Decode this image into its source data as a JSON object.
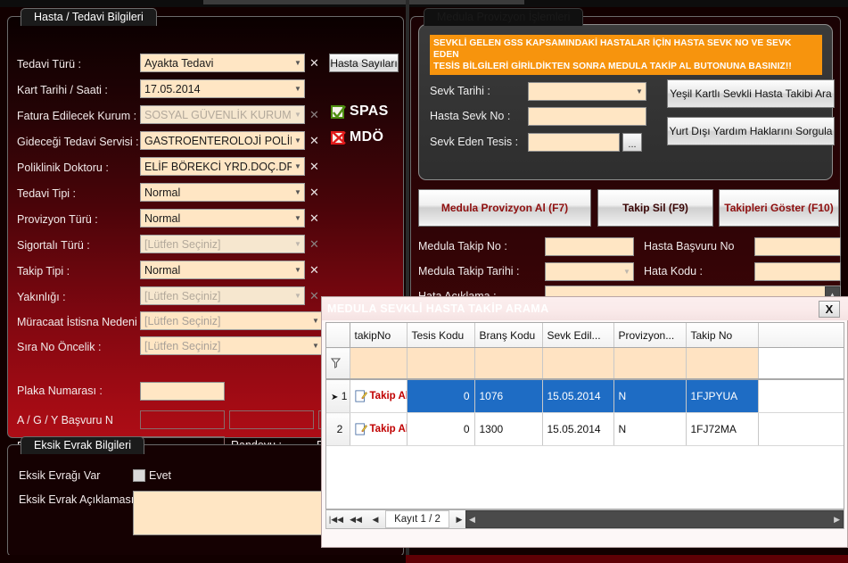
{
  "left_panel": {
    "title": "Hasta / Tedavi Bilgileri",
    "fields": [
      {
        "label": "Tedavi Türü :",
        "value": "Ayakta Tedavi",
        "disabled": false,
        "dropdown": true,
        "clear": true
      },
      {
        "label": "Kart Tarihi / Saati :",
        "value": "17.05.2014",
        "disabled": false,
        "dropdown": true,
        "clear": false
      },
      {
        "label": "Fatura Edilecek Kurum :",
        "value": "SOSYAL GÜVENLİK KURUMU (SGK)",
        "disabled": true,
        "dropdown": true,
        "clear": true
      },
      {
        "label": "Gideceği Tedavi Servisi :",
        "value": "GASTROENTEROLOJİ POLİK...",
        "disabled": false,
        "dropdown": true,
        "clear": true
      },
      {
        "label": "Poliklinik Doktoru :",
        "value": "ELİF BÖREKCİ YRD.DOÇ.DR.",
        "disabled": false,
        "dropdown": true,
        "clear": true
      },
      {
        "label": "Tedavi Tipi  :",
        "value": "Normal",
        "disabled": false,
        "dropdown": true,
        "clear": true
      },
      {
        "label": "Provizyon Türü :",
        "value": "Normal",
        "disabled": false,
        "dropdown": true,
        "clear": true
      },
      {
        "label": "Sigortalı Türü :",
        "value": "[Lütfen Seçiniz]",
        "disabled": true,
        "dropdown": true,
        "clear": true
      },
      {
        "label": "Takip Tipi :",
        "value": "Normal",
        "disabled": false,
        "dropdown": true,
        "clear": true
      },
      {
        "label": "Yakınlığı :",
        "value": "[Lütfen Seçiniz]",
        "disabled": true,
        "dropdown": true,
        "clear": true
      },
      {
        "label": "Müracaat İstisna Nedeni",
        "value": "[Lütfen Seçiniz]",
        "disabled": false,
        "dropdown": true,
        "clear": false
      },
      {
        "label": "Sıra No Öncelik   :",
        "value": "[Lütfen Seçiniz]",
        "disabled": false,
        "dropdown": true,
        "clear": false
      }
    ],
    "plaka_label": "Plaka Numarası :",
    "plaka_value": "",
    "agy_label": "A / G / Y Başvuru N",
    "fatura_no_label": "Fatura No :",
    "fatura_no_value": "",
    "randevu_label": "Randevu :",
    "randevu_value": "Ra",
    "hasta_sayilari_button": "Hasta Sayıları",
    "flags": [
      {
        "name": "SPAS",
        "state": "check",
        "color": "#4f8f12"
      },
      {
        "name": "MDÖ",
        "state": "cross",
        "color": "#e01b1b"
      }
    ]
  },
  "eksik_panel": {
    "title": "Eksik Evrak Bilgileri",
    "has_missing_label": "Eksik Evrağı Var",
    "checkbox_label": "Evet",
    "checkbox_checked": false,
    "description_label": "Eksik Evrak Açıklaması",
    "description_value": ""
  },
  "right_panel": {
    "title": "Medula Provizyon İşlemleri",
    "warning_line1": "SEVKLİ GELEN GSS KAPSAMINDAKİ HASTALAR İÇİN  HASTA SEVK NO VE SEVK EDEN",
    "warning_line2": "TESİS BİLGİLERİ GİRİLDİKTEN SONRA MEDULA TAKİP AL BUTONUNA BASINIZ!!",
    "warning_color": "#f7940d",
    "sevk_fields": [
      {
        "label": "Sevk Tarihi :",
        "value": "",
        "dropdown": true
      },
      {
        "label": "Hasta Sevk No :",
        "value": "",
        "dropdown": false
      },
      {
        "label": "Sevk Eden Tesis :",
        "value": "",
        "dropdown": false
      }
    ],
    "dots_button": "...",
    "side_buttons": [
      "Yeşil Kartlı Sevkli Hasta Takibi Ara",
      "Yurt Dışı Yardım Haklarını Sorgula"
    ],
    "action_buttons": [
      {
        "label": "Medula Provizyon Al (F7)",
        "color": "#8f0f0f"
      },
      {
        "label": "Takip Sil (F9)",
        "color": "#3a0606"
      },
      {
        "label": "Takipleri Göster (F10)",
        "color": "#8f0f0f"
      }
    ],
    "medula_fields": [
      {
        "label": "Medula Takip No :",
        "value": ""
      },
      {
        "label": "Hasta Başvuru No",
        "value": ""
      },
      {
        "label": "Medula Takip Tarihi :",
        "value": ""
      },
      {
        "label": "Hata Kodu :",
        "value": ""
      },
      {
        "label": "Hata Açıklama :",
        "value": ""
      }
    ]
  },
  "dialog": {
    "title": "MEDULA SEVKLİ HASTA TAKİP ARAMA",
    "close_label": "X",
    "columns": [
      "takipNo",
      "Tesis Kodu",
      "Branş Kodu",
      "Sevk Edil...",
      "Provizyon...",
      "Takip No"
    ],
    "filter_row": [
      "",
      "",
      "",
      "",
      "",
      ""
    ],
    "rows": [
      {
        "index": "1",
        "selected": true,
        "action": "Takip Al",
        "takipNo": "0",
        "tesis_kodu": "1076",
        "brans_kodu": "15.05.2014",
        "sevk_edilen": "N",
        "provizyon": "1FJPYUA",
        "takip_no": ""
      },
      {
        "index": "2",
        "selected": false,
        "action": "Takip Al",
        "takipNo": "0",
        "tesis_kodu": "1300",
        "brans_kodu": "15.05.2014",
        "sevk_edilen": "N",
        "provizyon": "1FJ72MA",
        "takip_no": ""
      }
    ],
    "nav": {
      "first": "|◀◀",
      "prev_page": "◀◀",
      "prev": "◀",
      "label": "Kayıt 1 / 2",
      "next": "▶",
      "next_page": "▶▶",
      "last": "▶▶|"
    }
  }
}
